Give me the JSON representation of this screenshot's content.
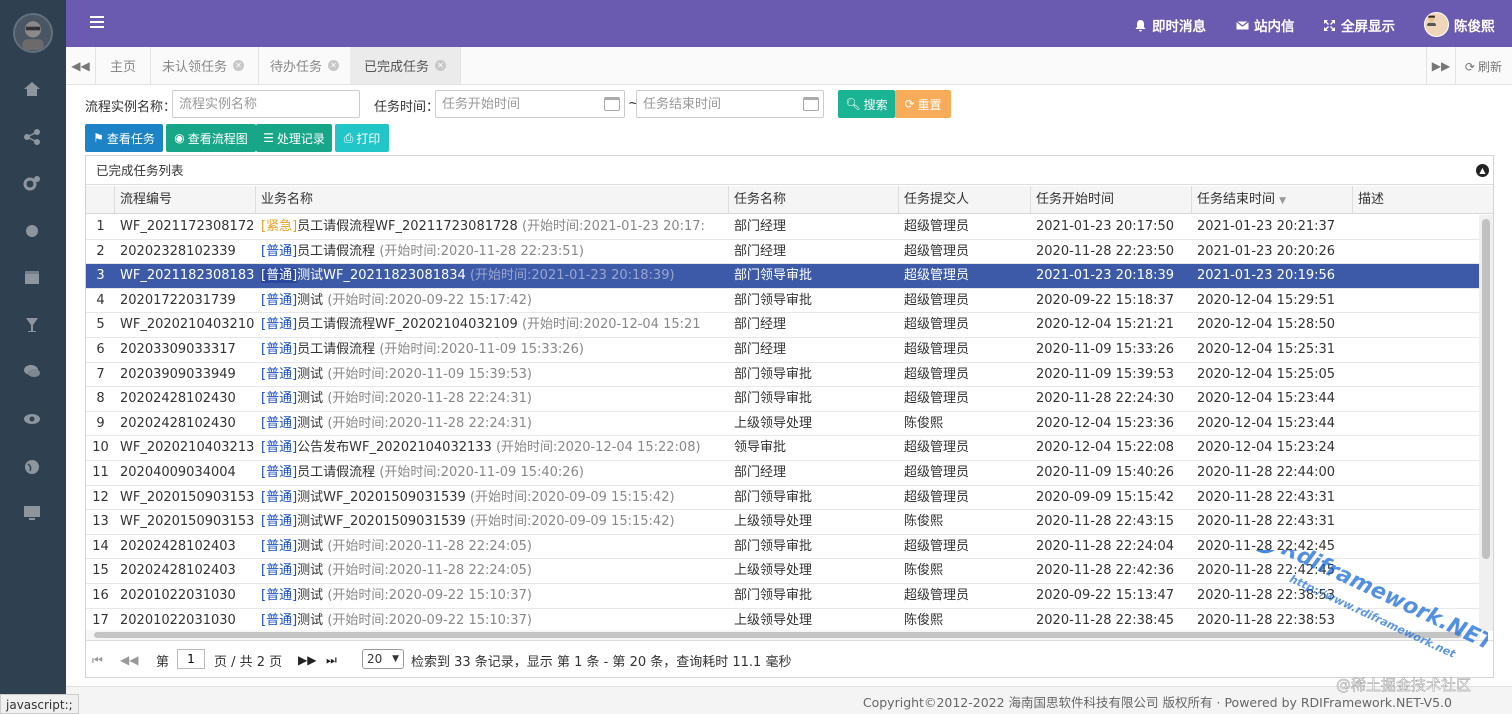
{
  "sidebar": {
    "icons": [
      "home-icon",
      "share-icon",
      "cogs-icon",
      "circle-icon",
      "calendar-icon",
      "trophy-icon",
      "comments-icon",
      "eye-icon",
      "globe-icon",
      "desktop-icon"
    ]
  },
  "topbar": {
    "bg": "#6a5bb0",
    "items": [
      {
        "label": "即时消息",
        "icon": "bell-icon"
      },
      {
        "label": "站内信",
        "icon": "envelope-icon"
      },
      {
        "label": "全屏显示",
        "icon": "expand-icon"
      }
    ],
    "user_name": "陈俊熙"
  },
  "tabs": {
    "items": [
      {
        "label": "主页",
        "closable": false
      },
      {
        "label": "未认领任务",
        "closable": true
      },
      {
        "label": "待办任务",
        "closable": true
      },
      {
        "label": "已完成任务",
        "closable": true,
        "active": true
      }
    ],
    "refresh": "刷新"
  },
  "search": {
    "process_label": "流程实例名称：",
    "process_placeholder": "流程实例名称",
    "time_label": "任务时间：",
    "start_placeholder": "任务开始时间",
    "sep": "~",
    "end_placeholder": "任务结束时间",
    "search_btn": "搜索",
    "reset_btn": "重置"
  },
  "toolbar": {
    "view_task": "查看任务",
    "view_flow": "查看流程图",
    "records": "处理记录",
    "print": "打印"
  },
  "grid": {
    "title": "已完成任务列表",
    "columns": [
      "流程编号",
      "业务名称",
      "任务名称",
      "任务提交人",
      "任务开始时间",
      "任务结束时间",
      "描述"
    ],
    "rows": [
      {
        "n": "1",
        "code": "WF_2021172308172",
        "tag": "紧急",
        "urgent": true,
        "biz": "员工请假流程WF_20211723081728",
        "start": "(开始时间:2021-01-23 20:17:",
        "task": "部门经理",
        "user": "超级管理员",
        "ts": "2021-01-23 20:17:50",
        "te": "2021-01-23 20:21:37"
      },
      {
        "n": "2",
        "code": "20202328102339",
        "tag": "普通",
        "biz": "员工请假流程",
        "start": "(开始时间:2020-11-28 22:23:51)",
        "task": "部门经理",
        "user": "超级管理员",
        "ts": "2020-11-28 22:23:50",
        "te": "2021-01-23 20:20:26"
      },
      {
        "n": "3",
        "code": "WF_2021182308183",
        "tag": "普通",
        "biz": "测试WF_20211823081834",
        "start": "(开始时间:2021-01-23 20:18:39)",
        "task": "部门领导审批",
        "user": "超级管理员",
        "ts": "2021-01-23 20:18:39",
        "te": "2021-01-23 20:19:56",
        "selected": true
      },
      {
        "n": "4",
        "code": "20201722031739",
        "tag": "普通",
        "biz": "测试",
        "start": "(开始时间:2020-09-22 15:17:42)",
        "task": "部门领导审批",
        "user": "超级管理员",
        "ts": "2020-09-22 15:18:37",
        "te": "2020-12-04 15:29:51"
      },
      {
        "n": "5",
        "code": "WF_2020210403210",
        "tag": "普通",
        "biz": "员工请假流程WF_20202104032109",
        "start": "(开始时间:2020-12-04 15:21",
        "task": "部门经理",
        "user": "超级管理员",
        "ts": "2020-12-04 15:21:21",
        "te": "2020-12-04 15:28:50"
      },
      {
        "n": "6",
        "code": "20203309033317",
        "tag": "普通",
        "biz": "员工请假流程",
        "start": "(开始时间:2020-11-09 15:33:26)",
        "task": "部门经理",
        "user": "超级管理员",
        "ts": "2020-11-09 15:33:26",
        "te": "2020-12-04 15:25:31"
      },
      {
        "n": "7",
        "code": "20203909033949",
        "tag": "普通",
        "biz": "测试",
        "start": "(开始时间:2020-11-09 15:39:53)",
        "task": "部门领导审批",
        "user": "超级管理员",
        "ts": "2020-11-09 15:39:53",
        "te": "2020-12-04 15:25:05"
      },
      {
        "n": "8",
        "code": "20202428102430",
        "tag": "普通",
        "biz": "测试",
        "start": "(开始时间:2020-11-28 22:24:31)",
        "task": "部门领导审批",
        "user": "超级管理员",
        "ts": "2020-11-28 22:24:30",
        "te": "2020-12-04 15:23:44"
      },
      {
        "n": "9",
        "code": "20202428102430",
        "tag": "普通",
        "biz": "测试",
        "start": "(开始时间:2020-11-28 22:24:31)",
        "task": "上级领导处理",
        "user": "陈俊熙",
        "ts": "2020-12-04 15:23:36",
        "te": "2020-12-04 15:23:44"
      },
      {
        "n": "10",
        "code": "WF_2020210403213",
        "tag": "普通",
        "biz": "公告发布WF_20202104032133",
        "start": "(开始时间:2020-12-04 15:22:08)",
        "task": "领导审批",
        "user": "超级管理员",
        "ts": "2020-12-04 15:22:08",
        "te": "2020-12-04 15:23:24"
      },
      {
        "n": "11",
        "code": "20204009034004",
        "tag": "普通",
        "biz": "员工请假流程",
        "start": "(开始时间:2020-11-09 15:40:26)",
        "task": "部门经理",
        "user": "超级管理员",
        "ts": "2020-11-09 15:40:26",
        "te": "2020-11-28 22:44:00"
      },
      {
        "n": "12",
        "code": "WF_2020150903153",
        "tag": "普通",
        "biz": "测试WF_20201509031539",
        "start": "(开始时间:2020-09-09 15:15:42)",
        "task": "部门领导审批",
        "user": "超级管理员",
        "ts": "2020-09-09 15:15:42",
        "te": "2020-11-28 22:43:31"
      },
      {
        "n": "13",
        "code": "WF_2020150903153",
        "tag": "普通",
        "biz": "测试WF_20201509031539",
        "start": "(开始时间:2020-09-09 15:15:42)",
        "task": "上级领导处理",
        "user": "陈俊熙",
        "ts": "2020-11-28 22:43:15",
        "te": "2020-11-28 22:43:31"
      },
      {
        "n": "14",
        "code": "20202428102403",
        "tag": "普通",
        "biz": "测试",
        "start": "(开始时间:2020-11-28 22:24:05)",
        "task": "部门领导审批",
        "user": "超级管理员",
        "ts": "2020-11-28 22:24:04",
        "te": "2020-11-28 22:42:45"
      },
      {
        "n": "15",
        "code": "20202428102403",
        "tag": "普通",
        "biz": "测试",
        "start": "(开始时间:2020-11-28 22:24:05)",
        "task": "上级领导处理",
        "user": "陈俊熙",
        "ts": "2020-11-28 22:42:36",
        "te": "2020-11-28 22:42:45"
      },
      {
        "n": "16",
        "code": "20201022031030",
        "tag": "普通",
        "biz": "测试",
        "start": "(开始时间:2020-09-22 15:10:37)",
        "task": "部门领导审批",
        "user": "超级管理员",
        "ts": "2020-09-22 15:13:47",
        "te": "2020-11-28 22:38:53"
      },
      {
        "n": "17",
        "code": "20201022031030",
        "tag": "普通",
        "biz": "测试",
        "start": "(开始时间:2020-09-22 15:10:37)",
        "task": "上级领导处理",
        "user": "陈俊熙",
        "ts": "2020-11-28 22:38:45",
        "te": "2020-11-28 22:38:53"
      }
    ]
  },
  "pager": {
    "page_prefix": "第",
    "page": "1",
    "page_suffix": "页 / 共 2 页",
    "page_size": "20",
    "summary": "检索到 33 条记录，显示 第 1 条 - 第 20 条，查询耗时 11.1 毫秒"
  },
  "footer": {
    "copyright": "Copyright©2012-2022 海南国思软件科技有限公司 版权所有 · Powered by RDIFramework.NET-V5.0"
  },
  "status_bar": "javascript:;",
  "watermark": {
    "line1": "Rdiframework.NET",
    "line2": "http://www.rdiframework.net",
    "line3": "@稀土掘金技术社区"
  },
  "colors": {
    "selected_row": "#3d5aa8",
    "search_btn": "#1ab394",
    "reset_btn": "#f8ac59",
    "view_btn": "#1c84c6",
    "flow_btn": "#18a689",
    "print_btn": "#23c6c8"
  }
}
